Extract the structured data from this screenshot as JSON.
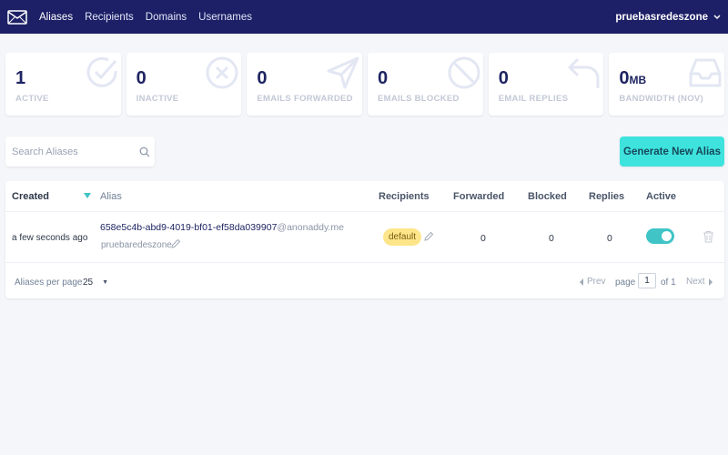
{
  "nav": {
    "links": [
      "Aliases",
      "Recipients",
      "Domains",
      "Usernames"
    ],
    "username": "pruebasredeszone"
  },
  "stats": [
    {
      "value": "1",
      "unit": "",
      "label": "ACTIVE",
      "icon": "check-circle-icon"
    },
    {
      "value": "0",
      "unit": "",
      "label": "INACTIVE",
      "icon": "x-circle-icon"
    },
    {
      "value": "0",
      "unit": "",
      "label": "EMAILS FORWARDED",
      "icon": "send-icon"
    },
    {
      "value": "0",
      "unit": "",
      "label": "EMAILS BLOCKED",
      "icon": "blocked-icon"
    },
    {
      "value": "0",
      "unit": "",
      "label": "EMAIL REPLIES",
      "icon": "reply-icon"
    },
    {
      "value": "0",
      "unit": "MB",
      "label": "BANDWIDTH (NOV)",
      "icon": "inbox-icon"
    }
  ],
  "search": {
    "placeholder": "Search Aliases"
  },
  "generate_button": "Generate New Alias",
  "table": {
    "headers": {
      "created": "Created",
      "alias": "Alias",
      "recipients": "Recipients",
      "forwarded": "Forwarded",
      "blocked": "Blocked",
      "replies": "Replies",
      "active": "Active"
    },
    "rows": [
      {
        "created": "a few seconds ago",
        "alias_local": "658e5c4b-abd9-4019-bf01-ef58da039907",
        "alias_domain": "@anonaddy.me",
        "description": "pruebaredeszone",
        "recipient": "default",
        "forwarded": "0",
        "blocked": "0",
        "replies": "0",
        "active": true
      }
    ]
  },
  "pagination": {
    "per_page_label": "Aliases per page",
    "per_page": "25",
    "prev": "Prev",
    "page_label": "page",
    "page": "1",
    "of": "of 1",
    "next": "Next"
  },
  "colors": {
    "nav_bg": "#1d2066",
    "accent": "#3ee3dd",
    "toggle_on": "#40c4c6",
    "badge_bg": "#fde68a",
    "icon_muted": "#e3e7f3"
  }
}
